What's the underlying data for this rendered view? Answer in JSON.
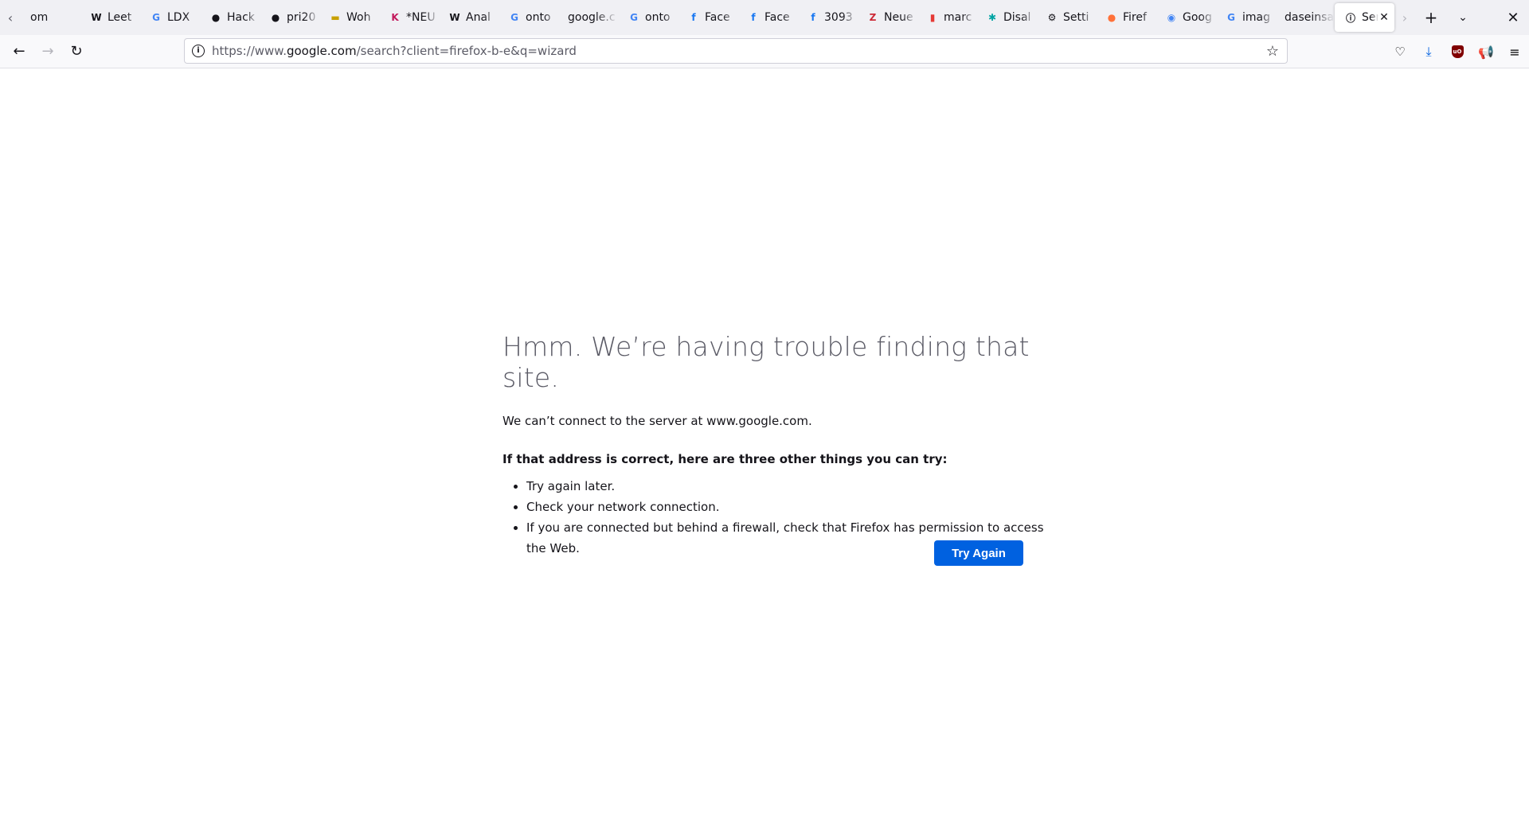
{
  "tabs": [
    {
      "label": "om",
      "icon": "tab-icon-generic",
      "icon_glyph": "",
      "icon_color": "#15141a"
    },
    {
      "label": "Leet",
      "icon": "wikipedia-icon",
      "icon_glyph": "W",
      "icon_color": "#15141a"
    },
    {
      "label": "LDX",
      "icon": "google-icon",
      "icon_glyph": "G",
      "icon_color": "#4285f4"
    },
    {
      "label": "Hack",
      "icon": "github-icon",
      "icon_glyph": "●",
      "icon_color": "#15141a"
    },
    {
      "label": "pri20",
      "icon": "github-icon",
      "icon_glyph": "●",
      "icon_color": "#15141a"
    },
    {
      "label": "Woh",
      "icon": "site-icon-yellow",
      "icon_glyph": "▬",
      "icon_color": "#c8a000"
    },
    {
      "label": "*NEU",
      "icon": "site-icon-k",
      "icon_glyph": "K",
      "icon_color": "#c2185b"
    },
    {
      "label": "Anal",
      "icon": "wikipedia-icon",
      "icon_glyph": "W",
      "icon_color": "#15141a"
    },
    {
      "label": "onto",
      "icon": "google-icon",
      "icon_glyph": "G",
      "icon_color": "#4285f4"
    },
    {
      "label": "google.c",
      "icon": "none",
      "icon_glyph": "",
      "icon_color": "#15141a"
    },
    {
      "label": "onto",
      "icon": "google-icon",
      "icon_glyph": "G",
      "icon_color": "#4285f4"
    },
    {
      "label": "Face",
      "icon": "facebook-icon",
      "icon_glyph": "f",
      "icon_color": "#1877f2"
    },
    {
      "label": "Face",
      "icon": "facebook-icon",
      "icon_glyph": "f",
      "icon_color": "#1877f2"
    },
    {
      "label": "3093",
      "icon": "facebook-icon",
      "icon_glyph": "f",
      "icon_color": "#1877f2"
    },
    {
      "label": "Neue",
      "icon": "zotero-icon",
      "icon_glyph": "Z",
      "icon_color": "#cc2936"
    },
    {
      "label": "marc",
      "icon": "site-icon-red",
      "icon_glyph": "▮",
      "icon_color": "#e53935"
    },
    {
      "label": "Disal",
      "icon": "puzzle-icon",
      "icon_glyph": "✱",
      "icon_color": "#00a3a3"
    },
    {
      "label": "Setti",
      "icon": "gear-icon",
      "icon_glyph": "⚙",
      "icon_color": "#15141a"
    },
    {
      "label": "Firef",
      "icon": "firefox-icon",
      "icon_glyph": "●",
      "icon_color": "#ff7139"
    },
    {
      "label": "Goog",
      "icon": "google-lens-icon",
      "icon_glyph": "◉",
      "icon_color": "#4285f4"
    },
    {
      "label": "imag",
      "icon": "google-icon",
      "icon_glyph": "G",
      "icon_color": "#4285f4"
    },
    {
      "label": "daseinsa",
      "icon": "none",
      "icon_glyph": "",
      "icon_color": "#15141a"
    },
    {
      "label": "Ser",
      "icon": "info-icon",
      "icon_glyph": "ⓘ",
      "icon_color": "#15141a",
      "active": true
    }
  ],
  "toolbar": {
    "url_prefix": "https://www.",
    "url_domain": "google.com",
    "url_path": "/search?client=firefox-b-e&q=wizard"
  },
  "error": {
    "title": "Hmm. We’re having trouble finding that site.",
    "description": "We can’t connect to the server at www.google.com.",
    "lead": "If that address is correct, here are three other things you can try:",
    "items": [
      "Try again later.",
      "Check your network connection.",
      "If you are connected but behind a firewall, check that Firefox has permission to access the Web."
    ],
    "button_label": "Try Again",
    "button_color": "#0061e0"
  }
}
